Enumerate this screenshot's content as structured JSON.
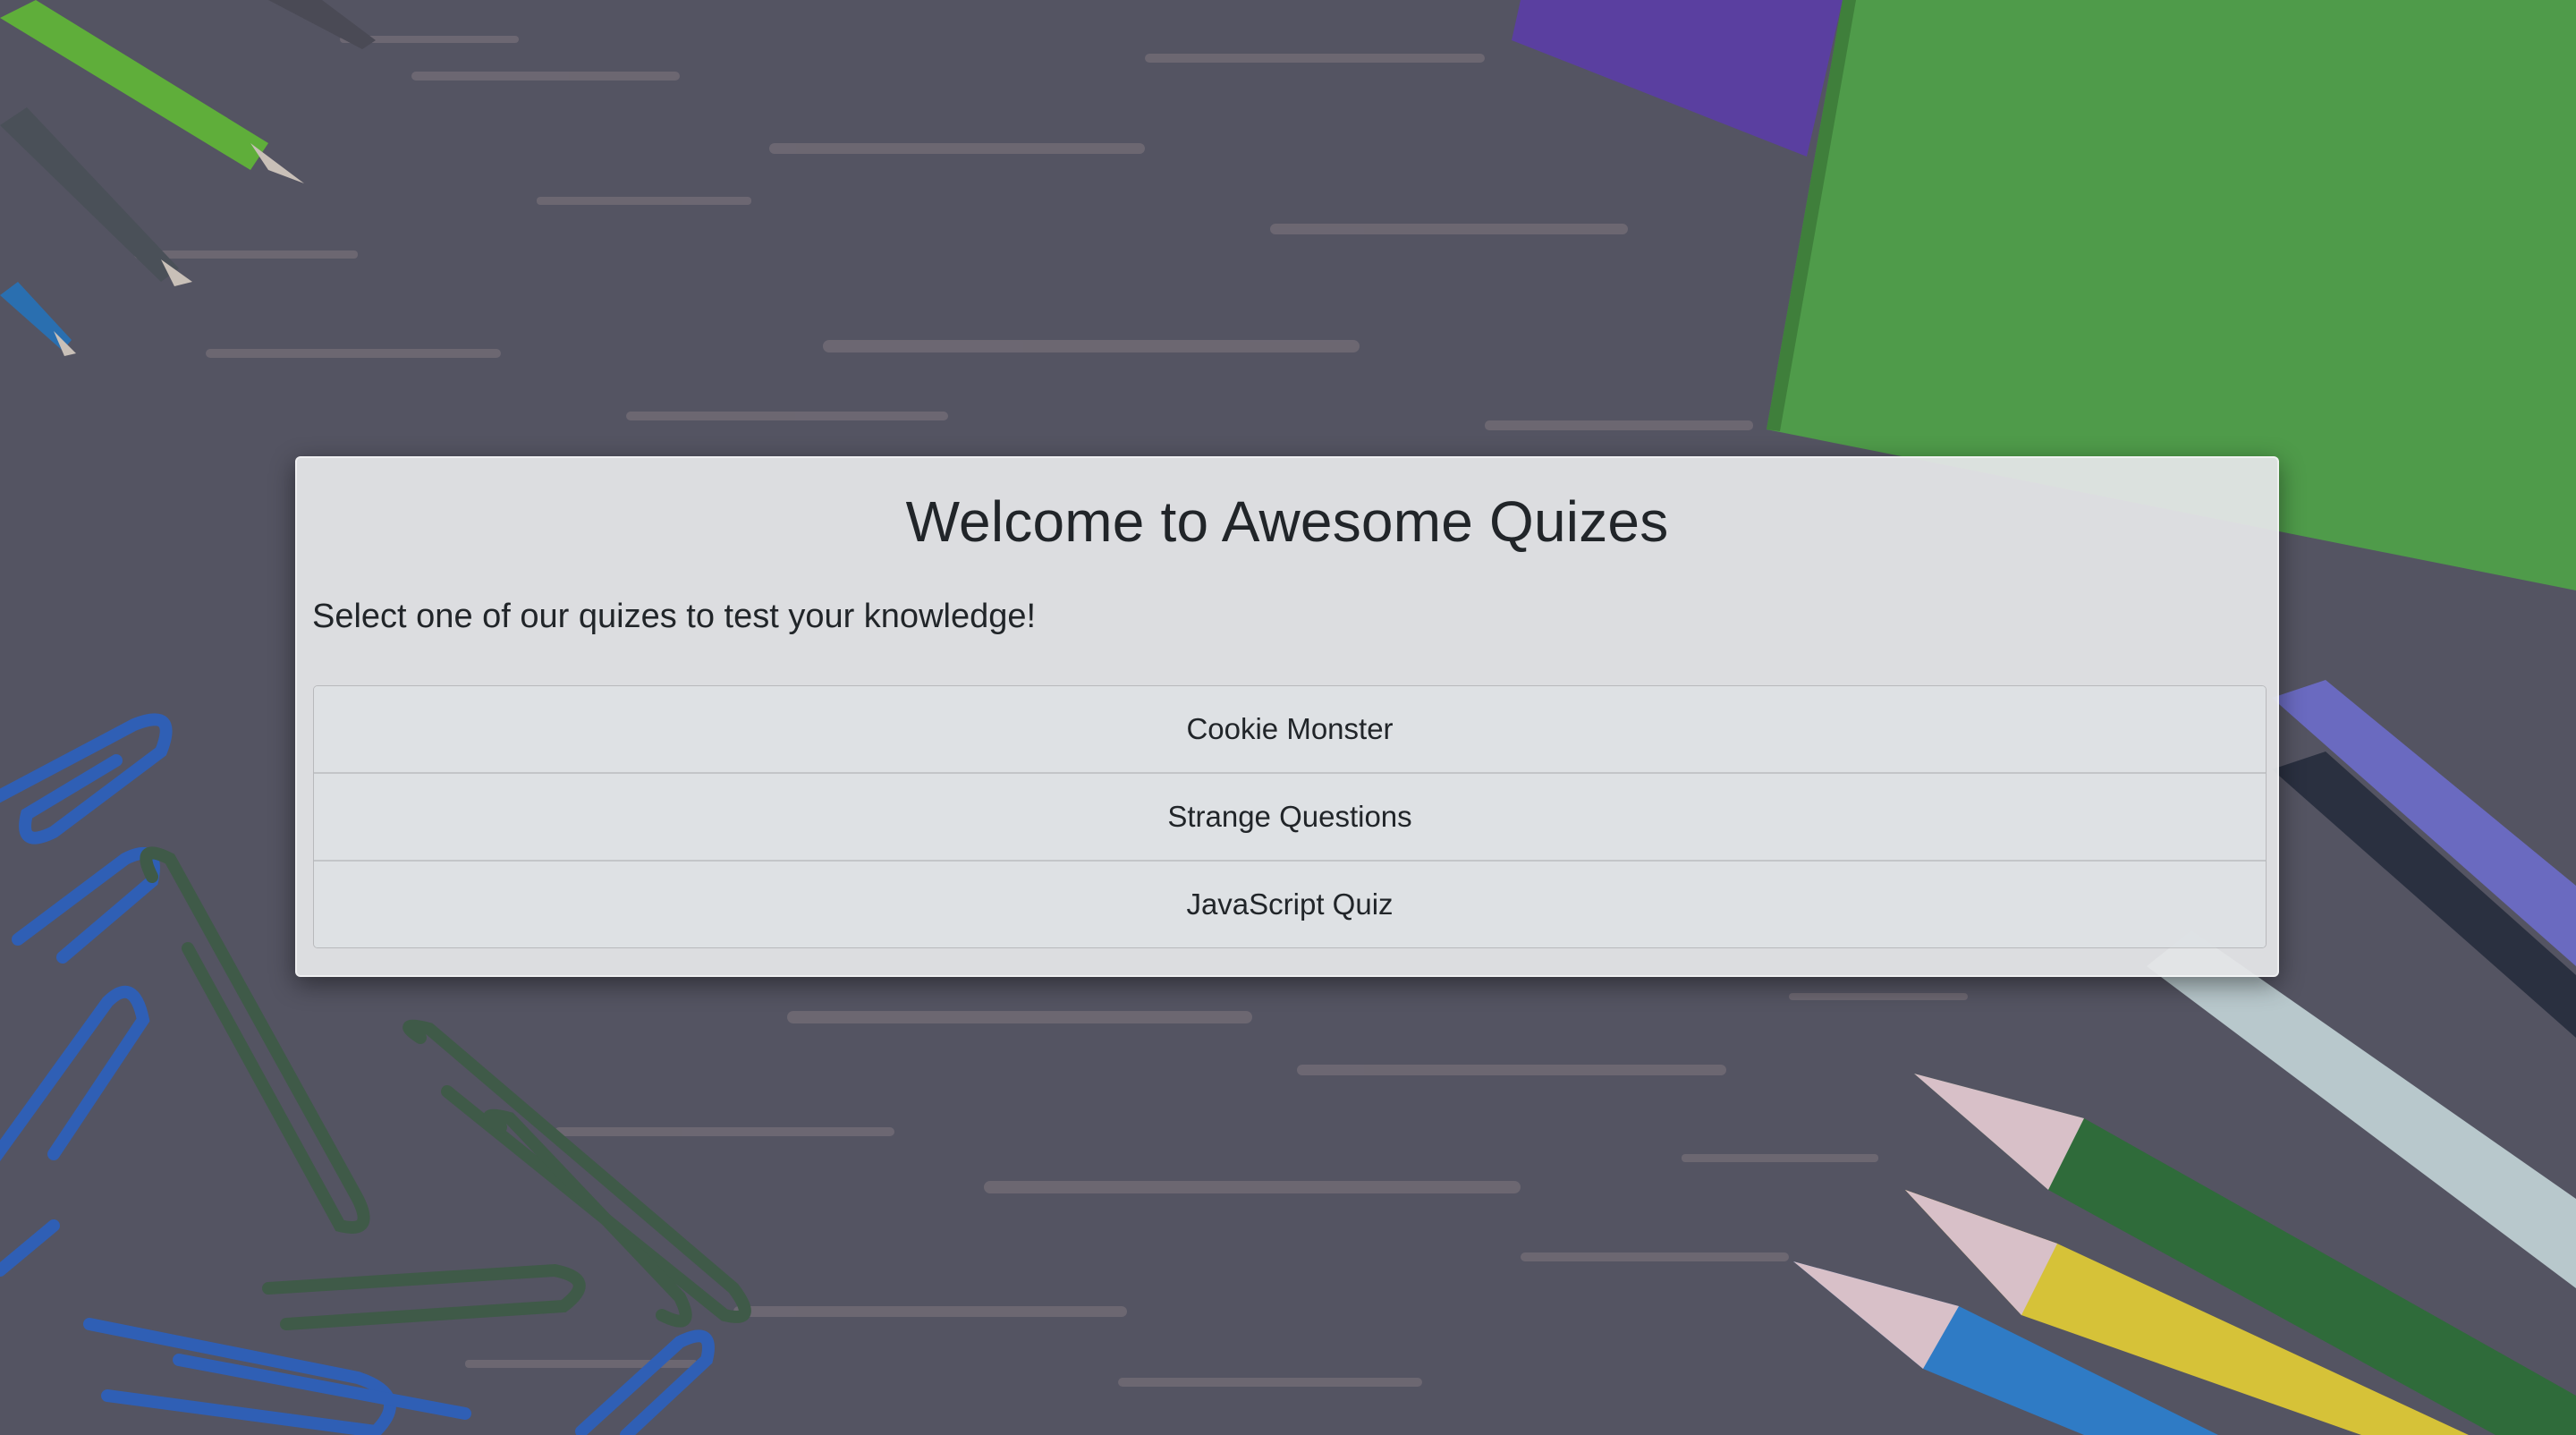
{
  "page": {
    "title": "Welcome to Awesome Quizes",
    "subtitle": "Select one of our quizes to test your knowledge!"
  },
  "quizzes": [
    {
      "label": "Cookie Monster"
    },
    {
      "label": "Strange Questions"
    },
    {
      "label": "JavaScript Quiz"
    }
  ],
  "colors": {
    "background": "#545462",
    "panel": "#e4e6e8",
    "text": "#212529",
    "notebook_green": "#4f9b4a",
    "notebook_purple": "#5a3fa0"
  },
  "icons": [
    "pens-decoration",
    "notebook-decoration",
    "paperclips-decoration",
    "colored-pencils-decoration"
  ]
}
